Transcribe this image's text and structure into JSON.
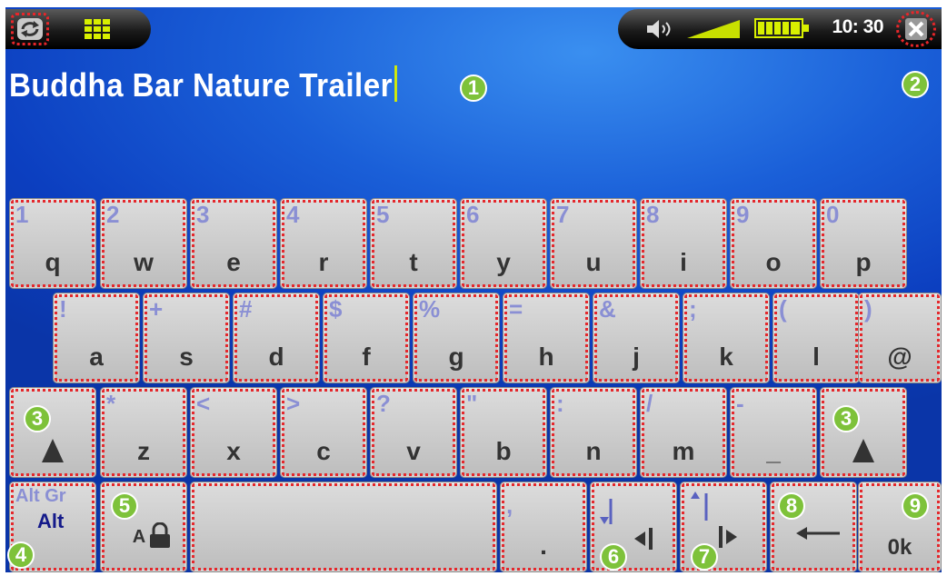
{
  "status": {
    "time": "10: 30",
    "icons": [
      "refresh-icon",
      "grid-icon",
      "speaker-icon",
      "signal-icon",
      "battery-icon",
      "close-icon"
    ]
  },
  "input": {
    "text": "Buddha Bar Nature Trailer"
  },
  "callouts": [
    "1",
    "2",
    "3",
    "3",
    "4",
    "5",
    "6",
    "7",
    "8",
    "9"
  ],
  "keyboard": {
    "row1": [
      {
        "alt": "1",
        "key": "q"
      },
      {
        "alt": "2",
        "key": "w"
      },
      {
        "alt": "3",
        "key": "e"
      },
      {
        "alt": "4",
        "key": "r"
      },
      {
        "alt": "5",
        "key": "t"
      },
      {
        "alt": "6",
        "key": "y"
      },
      {
        "alt": "7",
        "key": "u"
      },
      {
        "alt": "8",
        "key": "i"
      },
      {
        "alt": "9",
        "key": "o"
      },
      {
        "alt": "0",
        "key": "p"
      }
    ],
    "row2": [
      {
        "alt": "!",
        "key": "a"
      },
      {
        "alt": "+",
        "key": "s"
      },
      {
        "alt": "#",
        "key": "d"
      },
      {
        "alt": "$",
        "key": "f"
      },
      {
        "alt": "%",
        "key": "g"
      },
      {
        "alt": "=",
        "key": "h"
      },
      {
        "alt": "&",
        "key": "j"
      },
      {
        "alt": ";",
        "key": "k"
      },
      {
        "alt": "(",
        "key": "l"
      },
      {
        "alt": ")",
        "key": "@"
      }
    ],
    "row3": [
      {
        "alt": "*",
        "key": "z"
      },
      {
        "alt": "<",
        "key": "x"
      },
      {
        "alt": ">",
        "key": "c"
      },
      {
        "alt": "?",
        "key": "v"
      },
      {
        "alt": "\"",
        "key": "b"
      },
      {
        "alt": ":",
        "key": "n"
      },
      {
        "alt": "/",
        "key": "m"
      },
      {
        "alt": "-",
        "key": "_"
      }
    ],
    "altgr_label": "Alt Gr",
    "alt_label": "Alt",
    "caps_label": "A",
    "comma_alt": ",",
    "period_key": ".",
    "ok_label": "0k"
  }
}
